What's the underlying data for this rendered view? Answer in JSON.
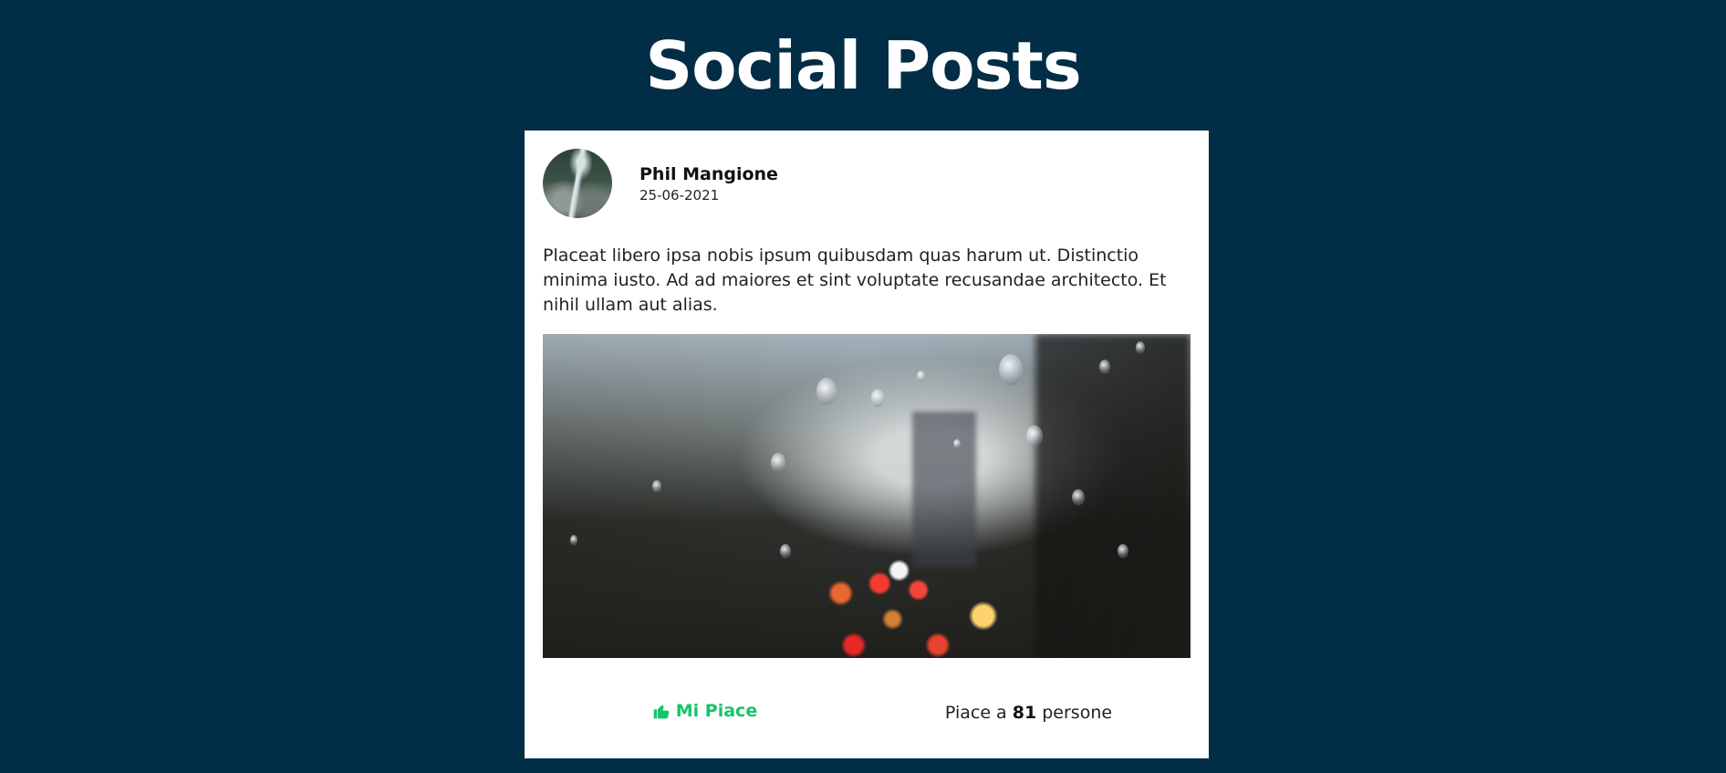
{
  "page": {
    "title": "Social Posts"
  },
  "post": {
    "author_name": "Phil Mangione",
    "date": "25-06-2021",
    "text": "Placeat libero ipsa nobis ipsum quibusdam quas harum ut. Distinctio minima iusto. Ad ad maiores et sint voluptate recusandae architecto. Et nihil ullam aut alias.",
    "like_label": "Mi Piace",
    "likes_prefix": "Piace a",
    "likes_count": "81",
    "likes_suffix": "persone"
  },
  "colors": {
    "background": "#022d46",
    "card": "#ffffff",
    "like_accent": "#16c46a"
  },
  "icons": {
    "like": "thumbs-up-icon"
  }
}
